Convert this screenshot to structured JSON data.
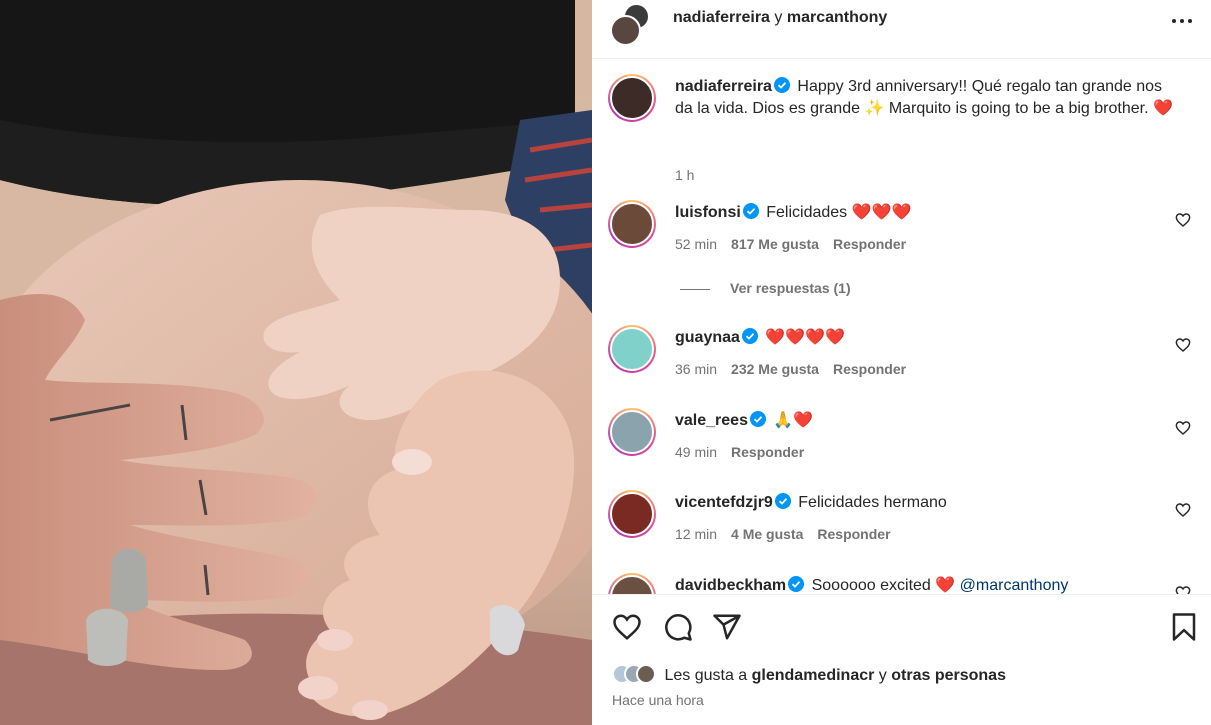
{
  "header": {
    "user1": "nadiaferreira",
    "conjunction": "y",
    "user2": "marcanthony"
  },
  "caption": {
    "user": "nadiaferreira",
    "text": "Happy 3rd anniversary!! Qué regalo tan grande nos da la vida. Dios es grande ✨ Marquito is going to be a big brother. ❤️",
    "time": "1 h"
  },
  "comments": [
    {
      "user": "luisfonsi",
      "text": "Felicidades ❤️❤️❤️",
      "time": "52 min",
      "likes": "817 Me gusta",
      "reply": "Responder",
      "avatar_color": "#6b4a3a"
    },
    {
      "user": "guaynaa",
      "text": "❤️❤️❤️❤️",
      "time": "36 min",
      "likes": "232 Me gusta",
      "reply": "Responder",
      "avatar_color": "#7fd1c9"
    },
    {
      "user": "vale_rees",
      "text": "🙏❤️",
      "time": "49 min",
      "likes": "",
      "reply": "Responder",
      "avatar_color": "#8aa3ad"
    },
    {
      "user": "vicentefdzjr9",
      "text": "Felicidades hermano",
      "time": "12 min",
      "likes": "4 Me gusta",
      "reply": "Responder",
      "avatar_color": "#7a2a22"
    },
    {
      "user": "davidbeckham",
      "text": "Soooooo excited ❤️",
      "mention": "@marcanthony",
      "avatar_color": "#6a5040"
    }
  ],
  "view_replies": "Ver respuestas (1)",
  "footer": {
    "likes_prefix": "Les gusta a",
    "likes_user": "glendamedinacr",
    "likes_conj": "y",
    "likes_others": "otras personas",
    "timestamp": "Hace una hora"
  },
  "colors": {
    "verified": "#0095f6",
    "text": "#262626",
    "secondary": "#737373",
    "mention": "#00376b"
  },
  "icons": [
    "more-icon",
    "heart-icon",
    "comment-icon",
    "share-icon",
    "bookmark-icon",
    "verified-icon"
  ]
}
